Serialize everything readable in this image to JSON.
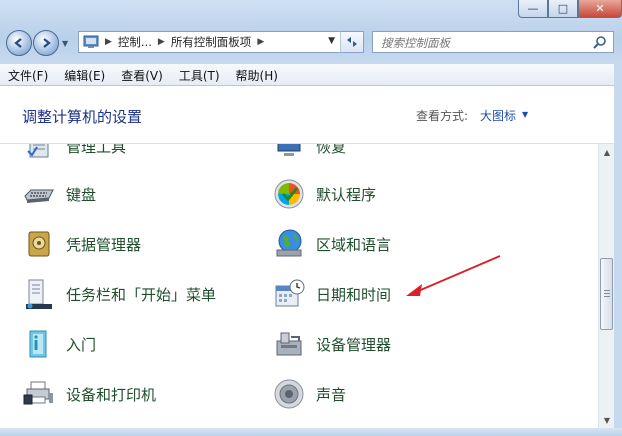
{
  "window": {
    "buttons": [
      "—",
      "□",
      "✕"
    ]
  },
  "nav": {
    "back_icon": "back-arrow-icon",
    "forward_icon": "forward-arrow-icon"
  },
  "address": {
    "parts": [
      "控制...",
      "所有控制面板项"
    ]
  },
  "search": {
    "placeholder": "搜索控制面板"
  },
  "menubar": [
    "文件(F)",
    "编辑(E)",
    "查看(V)",
    "工具(T)",
    "帮助(H)"
  ],
  "header": {
    "title": "调整计算机的设置",
    "view_label": "查看方式:",
    "view_value": "大图标"
  },
  "items": [
    {
      "label": "管理工具",
      "icon": "admin-tools-icon"
    },
    {
      "label": "恢复",
      "icon": "recovery-icon"
    },
    {
      "label": "键盘",
      "icon": "keyboard-icon"
    },
    {
      "label": "默认程序",
      "icon": "default-programs-icon"
    },
    {
      "label": "凭据管理器",
      "icon": "credential-manager-icon"
    },
    {
      "label": "区域和语言",
      "icon": "region-language-icon"
    },
    {
      "label": "任务栏和「开始」菜单",
      "icon": "taskbar-start-menu-icon"
    },
    {
      "label": "日期和时间",
      "icon": "date-time-icon"
    },
    {
      "label": "入门",
      "icon": "getting-started-icon"
    },
    {
      "label": "设备管理器",
      "icon": "device-manager-icon"
    },
    {
      "label": "设备和打印机",
      "icon": "devices-printers-icon"
    },
    {
      "label": "声音",
      "icon": "sound-icon"
    }
  ],
  "colors": {
    "title": "#1e3287",
    "link": "#1f4e2c",
    "annotation_arrow": "#d6232a"
  }
}
